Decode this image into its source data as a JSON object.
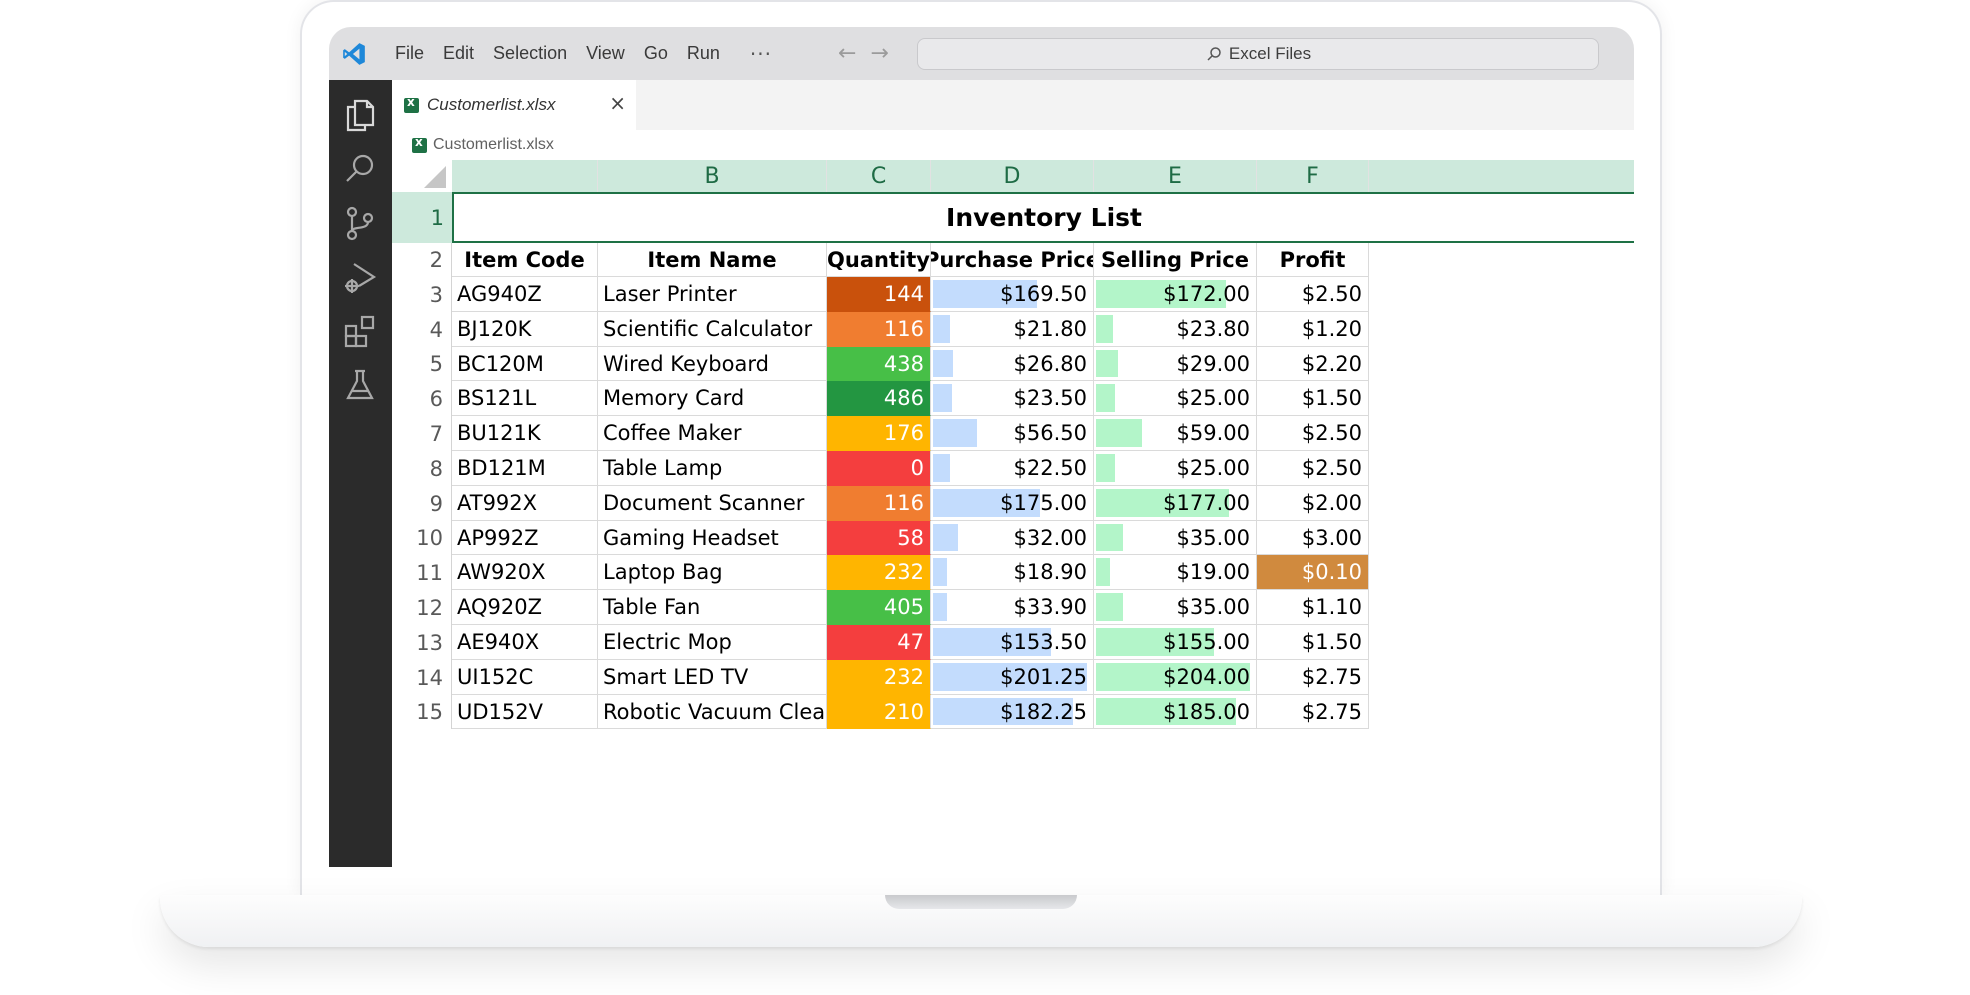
{
  "menu": [
    "File",
    "Edit",
    "Selection",
    "View",
    "Go",
    "Run",
    "···"
  ],
  "nav": {
    "back": "←",
    "forward": "→"
  },
  "command_center": {
    "label": "Excel Files"
  },
  "tab": {
    "label": "Customerlist.xlsx",
    "close": "×"
  },
  "breadcrumb": {
    "label": "Customerlist.xlsx"
  },
  "activity_icons": [
    "explorer-icon",
    "search-icon",
    "source-control-icon",
    "run-debug-icon",
    "extensions-icon",
    "testing-icon"
  ],
  "columns": [
    "",
    "B",
    "C",
    "D",
    "E",
    "F"
  ],
  "sheet_title": "Inventory List",
  "headers": [
    "Item Code",
    "Item Name",
    "Quantity",
    "Purchase Price",
    "Selling Price",
    "Profit"
  ],
  "rows": [
    {
      "row": "3",
      "code": "AG940Z",
      "name": "Laser Printer",
      "qty": "144",
      "qty_color": "#c9510c",
      "purchase": "$169.50",
      "purchase_bar": 0.66,
      "selling": "$172.00",
      "selling_bar": 0.83,
      "profit": "$2.50",
      "profit_bg": ""
    },
    {
      "row": "4",
      "code": "BJ120K",
      "name": "Scientific Calculator",
      "qty": "116",
      "qty_color": "#f07d30",
      "purchase": "$21.80",
      "purchase_bar": 0.11,
      "selling": "$23.80",
      "selling_bar": 0.11,
      "profit": "$1.20",
      "profit_bg": ""
    },
    {
      "row": "5",
      "code": "BC120M",
      "name": "Wired Keyboard",
      "qty": "438",
      "qty_color": "#47bf47",
      "purchase": "$26.80",
      "purchase_bar": 0.13,
      "selling": "$29.00",
      "selling_bar": 0.14,
      "profit": "$2.20",
      "profit_bg": ""
    },
    {
      "row": "6",
      "code": "BS121L",
      "name": "Memory Card",
      "qty": "486",
      "qty_color": "#239641",
      "purchase": "$23.50",
      "purchase_bar": 0.12,
      "selling": "$25.00",
      "selling_bar": 0.12,
      "profit": "$1.50",
      "profit_bg": ""
    },
    {
      "row": "7",
      "code": "BU121K",
      "name": "Coffee Maker",
      "qty": "176",
      "qty_color": "#ffb500",
      "purchase": "$56.50",
      "purchase_bar": 0.28,
      "selling": "$59.00",
      "selling_bar": 0.29,
      "profit": "$2.50",
      "profit_bg": ""
    },
    {
      "row": "8",
      "code": "BD121M",
      "name": "Table Lamp",
      "qty": "0",
      "qty_color": "#f43e3e",
      "purchase": "$22.50",
      "purchase_bar": 0.11,
      "selling": "$25.00",
      "selling_bar": 0.12,
      "profit": "$2.50",
      "profit_bg": ""
    },
    {
      "row": "9",
      "code": "AT992X",
      "name": "Document Scanner",
      "qty": "116",
      "qty_color": "#f07d30",
      "purchase": "$175.00",
      "purchase_bar": 0.68,
      "selling": "$177.00",
      "selling_bar": 0.85,
      "profit": "$2.00",
      "profit_bg": ""
    },
    {
      "row": "10",
      "code": "AP992Z",
      "name": "Gaming Headset",
      "qty": "58",
      "qty_color": "#f43e3e",
      "purchase": "$32.00",
      "purchase_bar": 0.16,
      "selling": "$35.00",
      "selling_bar": 0.17,
      "profit": "$3.00",
      "profit_bg": ""
    },
    {
      "row": "11",
      "code": "AW920X",
      "name": "Laptop Bag",
      "qty": "232",
      "qty_color": "#ffb500",
      "purchase": "$18.90",
      "purchase_bar": 0.09,
      "selling": "$19.00",
      "selling_bar": 0.09,
      "profit": "$0.10",
      "profit_bg": "#d08a3e"
    },
    {
      "row": "12",
      "code": "AQ920Z",
      "name": "Table Fan",
      "qty": "405",
      "qty_color": "#47bf47",
      "purchase": "$33.90",
      "purchase_bar": 0.09,
      "selling": "$35.00",
      "selling_bar": 0.17,
      "profit": "$1.10",
      "profit_bg": ""
    },
    {
      "row": "13",
      "code": "AE940X",
      "name": "Electric Mop",
      "qty": "47",
      "qty_color": "#f43e3e",
      "purchase": "$153.50",
      "purchase_bar": 0.75,
      "selling": "$155.00",
      "selling_bar": 0.75,
      "profit": "$1.50",
      "profit_bg": ""
    },
    {
      "row": "14",
      "code": "UI152C",
      "name": "Smart LED TV",
      "qty": "232",
      "qty_color": "#ffb500",
      "purchase": "$201.25",
      "purchase_bar": 0.98,
      "selling": "$204.00",
      "selling_bar": 0.98,
      "profit": "$2.75",
      "profit_bg": ""
    },
    {
      "row": "15",
      "code": "UD152V",
      "name": "Robotic Vacuum Cleaner",
      "qty": "210",
      "qty_color": "#ffb500",
      "purchase": "$182.25",
      "purchase_bar": 0.89,
      "selling": "$185.00",
      "selling_bar": 0.89,
      "profit": "$2.75",
      "profit_bg": ""
    }
  ],
  "row_numbers_top": [
    "1",
    "2"
  ],
  "colors": {
    "purchase_bar": "#c3dcfd",
    "selling_bar": "#b3f5c9",
    "header_green": "#cde9dc",
    "accent": "#1e7145"
  }
}
